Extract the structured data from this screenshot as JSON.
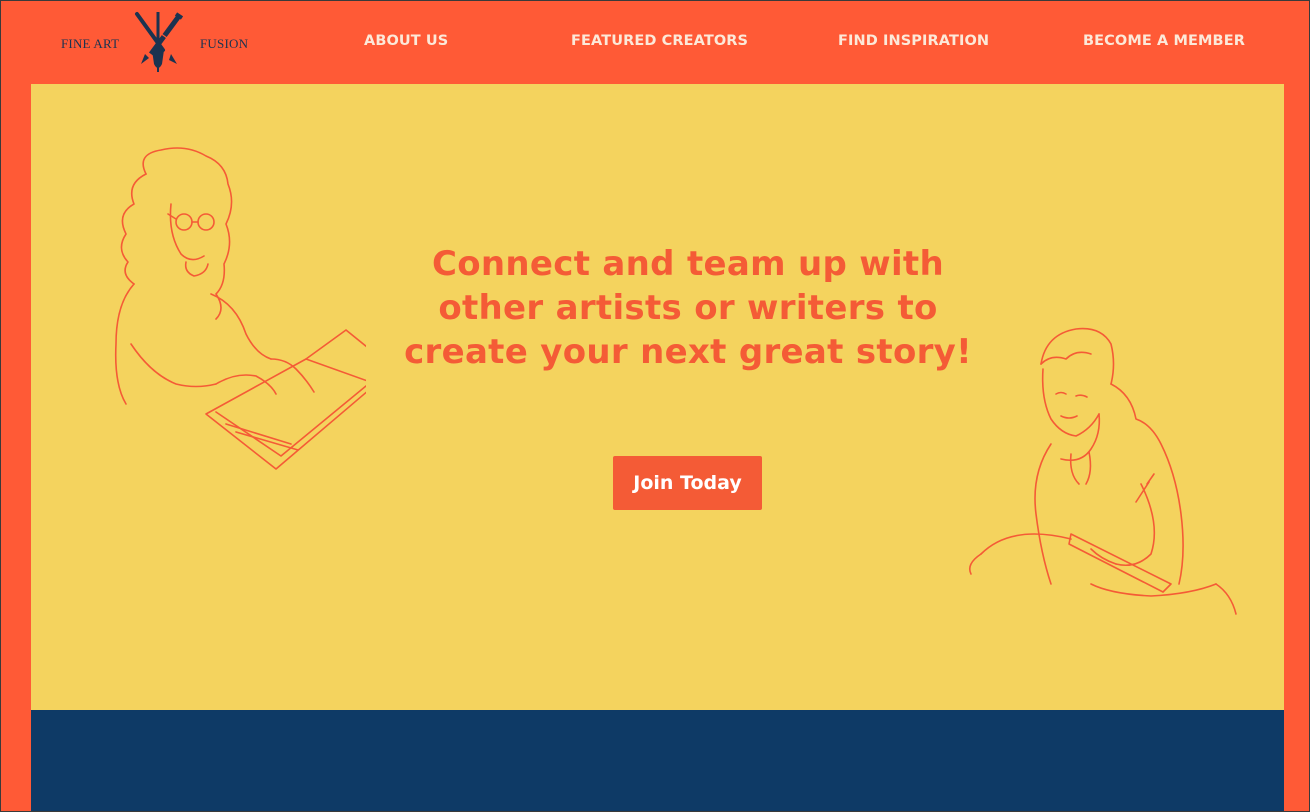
{
  "brand": {
    "left_text": "FINE ART",
    "right_text": "FUSION",
    "logo_icon": "brush-pencil-crossed-icon"
  },
  "nav": {
    "items": [
      {
        "label": "ABOUT US"
      },
      {
        "label": "FEATURED CREATORS"
      },
      {
        "label": "FIND INSPIRATION"
      },
      {
        "label": "BECOME A MEMBER"
      }
    ]
  },
  "hero": {
    "headline": "Connect and team up with other artists or writers to create your next great story!",
    "cta_label": "Join Today"
  },
  "colors": {
    "primary": "#FF5A36",
    "hero_bg": "#F4D35E",
    "accent_dark": "#0E3A66",
    "nav_text": "#FCE9D9"
  }
}
